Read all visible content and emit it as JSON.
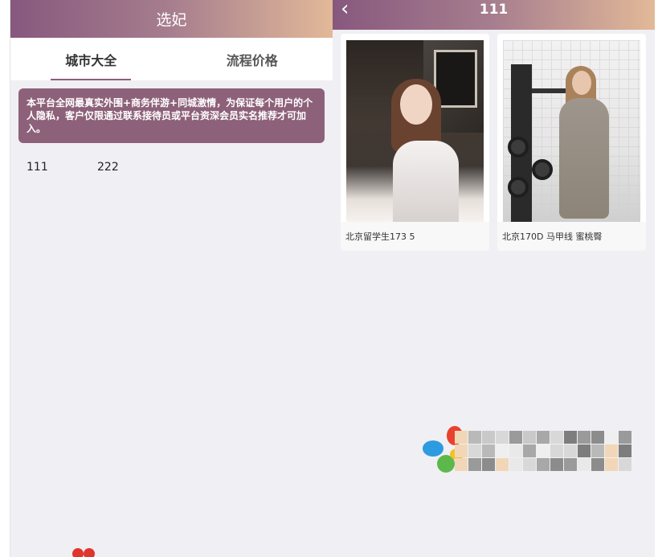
{
  "left": {
    "header_title": "选妃",
    "tabs": [
      {
        "label": "城市大全",
        "active": true
      },
      {
        "label": "流程价格",
        "active": false
      }
    ],
    "notice": "本平台全网最真实外围+商务伴游+同城激情，为保证每个用户的个人隐私，客户仅限通过联系接待员或平台资深会员实名推荐才可加入。",
    "cities": [
      "111",
      "222"
    ]
  },
  "right": {
    "header_title": "111",
    "back_icon": "chevron-left-icon",
    "cards": [
      {
        "caption": "北京留学生173 5"
      },
      {
        "caption": "北京170D 马甲线 蜜桃臀"
      }
    ]
  },
  "colors": {
    "header_gradient_start": "#87587e",
    "header_gradient_end": "#e2b998",
    "notice_bg": "#8d6179",
    "page_bg": "#f0eff3"
  }
}
